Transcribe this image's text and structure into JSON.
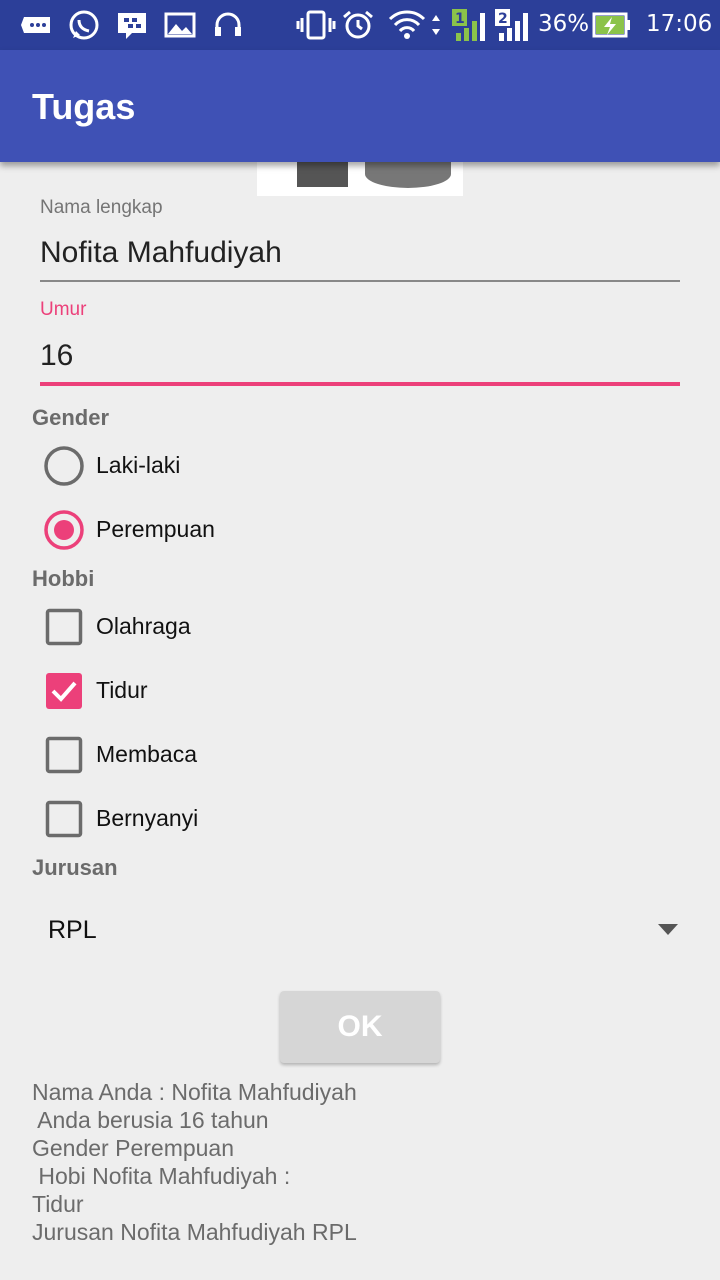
{
  "statusbar": {
    "battery_percent": "36%",
    "time": "17:06",
    "icons": [
      "message-icon",
      "whatsapp-icon",
      "bbm-icon",
      "gallery-icon",
      "headset-icon",
      "vibrate-icon",
      "alarm-icon",
      "wifi-icon",
      "signal-sim1-icon",
      "signal-sim2-icon",
      "battery-charging-icon"
    ]
  },
  "appbar": {
    "title": "Tugas"
  },
  "form": {
    "name_label": "Nama lengkap",
    "name_value": "Nofita Mahfudiyah",
    "age_label": "Umur",
    "age_value": "16"
  },
  "gender": {
    "label": "Gender",
    "options": [
      {
        "label": "Laki-laki",
        "checked": false
      },
      {
        "label": "Perempuan",
        "checked": true
      }
    ]
  },
  "hobbies": {
    "label": "Hobbi",
    "options": [
      {
        "label": "Olahraga",
        "checked": false
      },
      {
        "label": "Tidur",
        "checked": true
      },
      {
        "label": "Membaca",
        "checked": false
      },
      {
        "label": "Bernyanyi",
        "checked": false
      }
    ]
  },
  "major": {
    "label": "Jurusan",
    "selected": "RPL"
  },
  "ok_button": {
    "label": "OK"
  },
  "result": {
    "line1": "Nama Anda : Nofita Mahfudiyah",
    "line2": " Anda berusia 16 tahun",
    "line3": "Gender Perempuan",
    "line4": " Hobi Nofita Mahfudiyah :",
    "line5": "Tidur",
    "line6": "Jurusan Nofita Mahfudiyah RPL"
  },
  "colors": {
    "primary": "#3f51b5",
    "primary_dark": "#2c3f99",
    "accent": "#ec407a",
    "background": "#eeeeee"
  }
}
